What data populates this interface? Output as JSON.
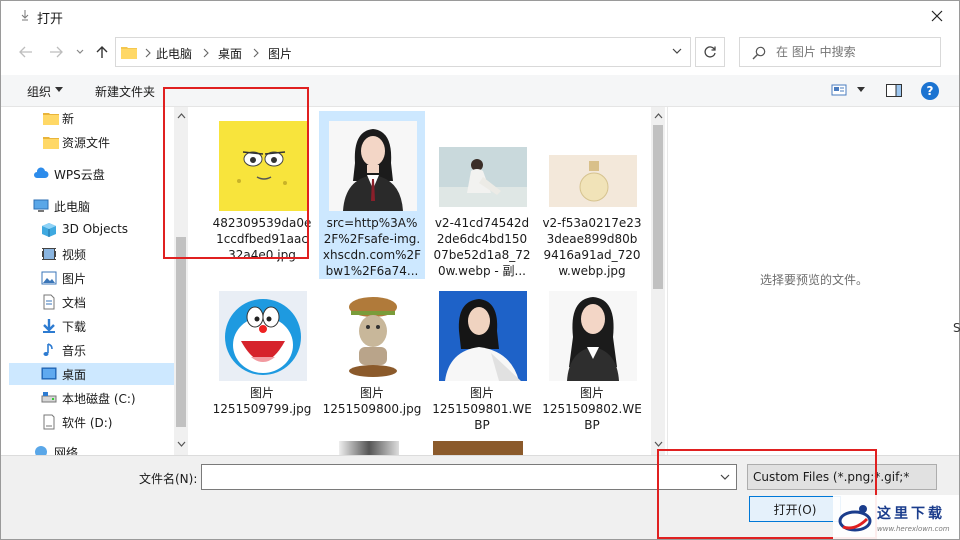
{
  "window": {
    "title": "打开"
  },
  "address": {
    "crumbs": [
      "此电脑",
      "桌面",
      "图片"
    ]
  },
  "search": {
    "placeholder": "在 图片 中搜索"
  },
  "toolbar": {
    "organize": "组织",
    "new_folder": "新建文件夹",
    "help": "?"
  },
  "nav": {
    "items": [
      {
        "label": "新",
        "icon": "folder-icon",
        "indent": 1
      },
      {
        "label": "资源文件",
        "icon": "folder-icon",
        "indent": 1
      },
      {
        "label": "WPS云盘",
        "icon": "cloud-icon",
        "indent": 0
      },
      {
        "label": "此电脑",
        "icon": "computer-icon",
        "indent": 0
      },
      {
        "label": "3D Objects",
        "icon": "cube-icon",
        "indent": 1
      },
      {
        "label": "视频",
        "icon": "video-icon",
        "indent": 1
      },
      {
        "label": "图片",
        "icon": "pictures-icon",
        "indent": 1
      },
      {
        "label": "文档",
        "icon": "document-icon",
        "indent": 1
      },
      {
        "label": "下载",
        "icon": "download-icon",
        "indent": 1
      },
      {
        "label": "音乐",
        "icon": "music-icon",
        "indent": 1
      },
      {
        "label": "桌面",
        "icon": "desktop-icon",
        "indent": 1,
        "selected": true
      },
      {
        "label": "本地磁盘 (C:)",
        "icon": "drive-icon",
        "indent": 1
      },
      {
        "label": "软件 (D:)",
        "icon": "drive-icon",
        "indent": 1
      },
      {
        "label": "网络",
        "icon": "network-icon",
        "indent": 0
      }
    ]
  },
  "files": [
    {
      "name": [
        "482309539da0e",
        "1ccdfbed91aac",
        "32a4e0.jpg"
      ],
      "thumb": "sponge"
    },
    {
      "name": [
        "src=http%3A%",
        "2F%2Fsafe-img.",
        "xhscdn.com%2F",
        "bw1%2F6a74..."
      ],
      "thumb": "portrait",
      "selected": true
    },
    {
      "name": [
        "v2-41cd74542d",
        "2de6dc4bd150",
        "07be52d1a8_72",
        "0w.webp - 副..."
      ],
      "thumb": "girl"
    },
    {
      "name": [
        "v2-f53a0217e23",
        "3deae899d80b",
        "9416a91ad_720",
        "w.webp.jpg"
      ],
      "thumb": "perfume"
    },
    {
      "name": [
        "图片",
        "1251509799.jpg"
      ],
      "thumb": "doraemon"
    },
    {
      "name": [
        "图片",
        "1251509800.jpg"
      ],
      "thumb": "burger"
    },
    {
      "name": [
        "图片",
        "1251509801.WE",
        "BP"
      ],
      "thumb": "bluegirl"
    },
    {
      "name": [
        "图片",
        "1251509802.WE",
        "BP"
      ],
      "thumb": "girl2"
    }
  ],
  "preview": {
    "text": "选择要预览的文件。"
  },
  "bottom": {
    "filename_label": "文件名(N):",
    "filename_value": "",
    "filter": "Custom Files (*.png;*.gif;*",
    "open": "打开(O)"
  },
  "colors": {
    "accent": "#0078d7",
    "highlight": "#e02020",
    "selected": "#cde8ff"
  },
  "watermark": {
    "title": "这里下载",
    "url": "www.herexlown.com"
  },
  "edge_text": "S"
}
